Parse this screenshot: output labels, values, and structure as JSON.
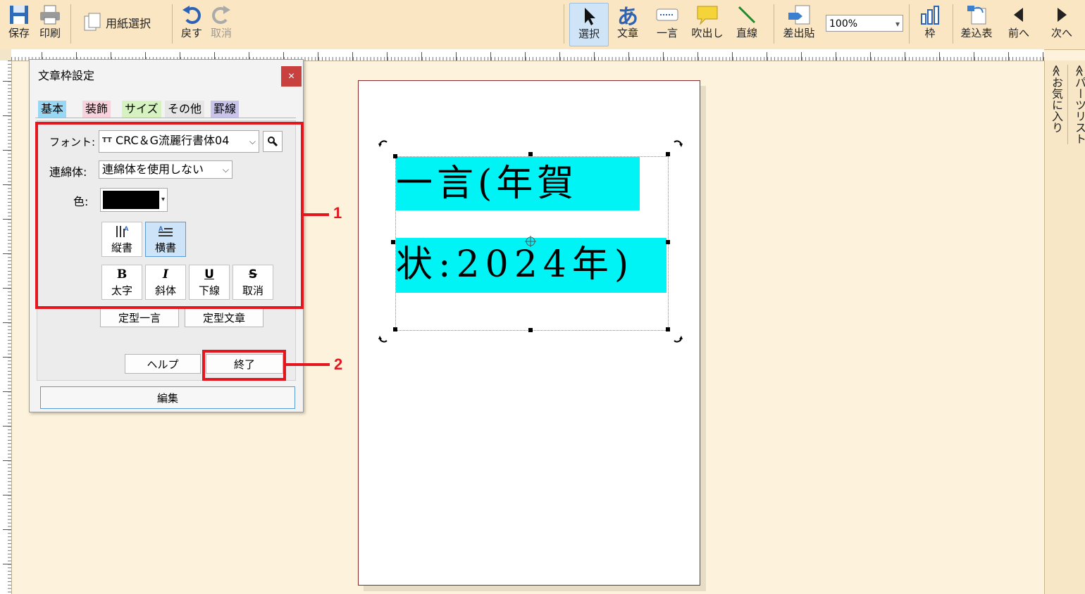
{
  "toolbar": {
    "save": "保存",
    "print": "印刷",
    "paper_select": "用紙選択",
    "undo": "戻す",
    "redo": "取消",
    "select": "選択",
    "text_glyph": "あ",
    "text": "文章",
    "phrase": "一言",
    "balloon": "吹出し",
    "line": "直線",
    "sender_paste": "差出貼",
    "zoom": "100%",
    "frame": "枠",
    "merge_table": "差込表",
    "prev": "前へ",
    "next": "次へ"
  },
  "side_tabs": {
    "favorites": "≪お気に入り",
    "parts_list": "≪パーツリスト"
  },
  "canvas": {
    "line1": "一言(年賀",
    "line2": "状:2024年)"
  },
  "dialog": {
    "title": "文章枠設定",
    "close": "×",
    "tabs": [
      "基本",
      "装飾",
      "サイズ",
      "その他",
      "罫線"
    ],
    "font_label": "フォント:",
    "font_value": "CRC＆G流麗行書体04",
    "font_type_icon": "TT",
    "renmen_label": "連綿体:",
    "renmen_value": "連綿体を使用しない",
    "color_label": "色:",
    "color_value": "#000000",
    "vertical": "縦書",
    "horizontal": "横書",
    "bold": "太字",
    "bold_glyph": "B",
    "italic": "斜体",
    "italic_glyph": "I",
    "underline": "下線",
    "underline_glyph": "U",
    "strike": "取消",
    "strike_glyph": "S",
    "template_phrase": "定型一言",
    "template_text": "定型文章",
    "help": "ヘルプ",
    "finish": "終了",
    "edit": "編集"
  },
  "callouts": [
    "1",
    "2"
  ],
  "colors": {
    "highlight": "#00f4f6",
    "callout": "#e4171e",
    "toolbar_bg": "#fbe6c4",
    "canvas_bg": "#fdf3dc"
  }
}
